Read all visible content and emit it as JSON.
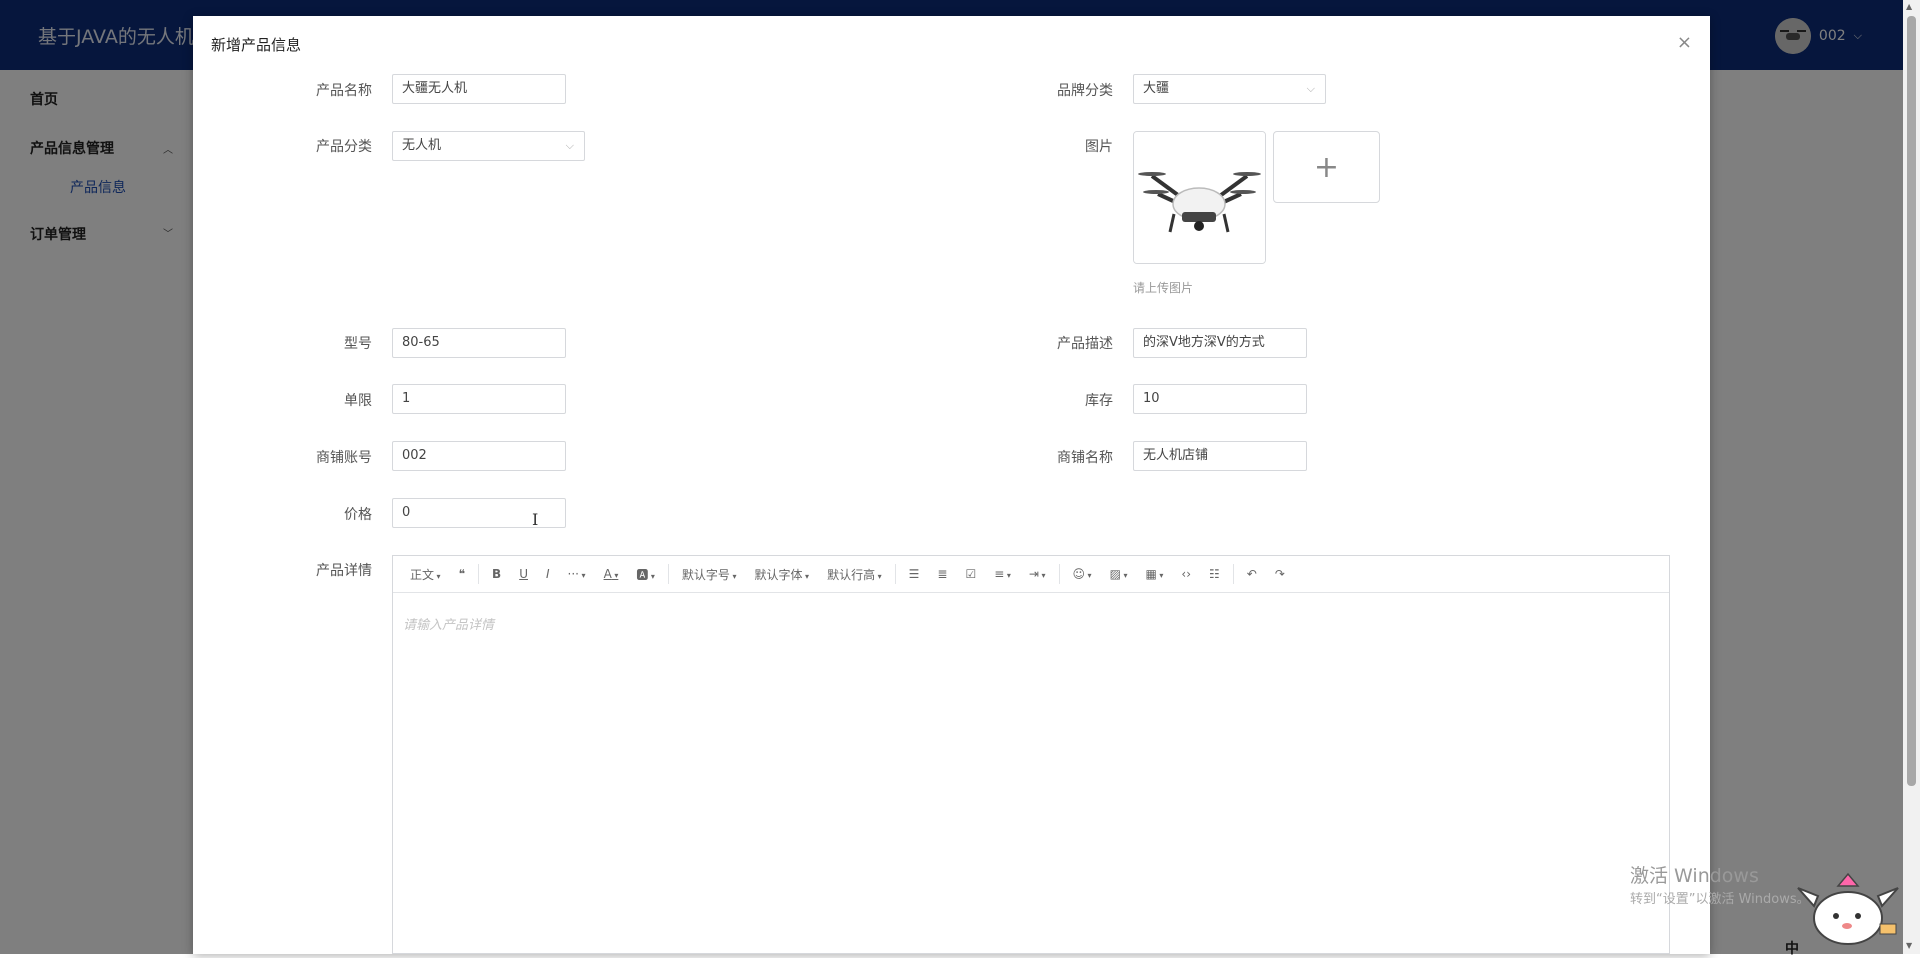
{
  "app": {
    "title": "基于JAVA的无人机",
    "user_name": "002"
  },
  "sidebar": {
    "items": [
      {
        "label": "首页"
      },
      {
        "label": "产品信息管理"
      },
      {
        "label": "订单管理"
      }
    ],
    "sub_items": [
      {
        "label": "产品信息"
      }
    ]
  },
  "dialog": {
    "title": "新增产品信息",
    "close_symbol": "×",
    "fields": {
      "product_name": {
        "label": "产品名称",
        "value": "大疆无人机"
      },
      "brand": {
        "label": "品牌分类",
        "value": "大疆"
      },
      "category": {
        "label": "产品分类",
        "value": "无人机"
      },
      "image": {
        "label": "图片",
        "hint": "请上传图片",
        "add_symbol": "+"
      },
      "model": {
        "label": "型号",
        "value": "80-65"
      },
      "description": {
        "label": "产品描述",
        "value": "的深V地方深V的方式"
      },
      "limit": {
        "label": "单限",
        "value": "1"
      },
      "stock": {
        "label": "库存",
        "value": "10"
      },
      "shop_account": {
        "label": "商铺账号",
        "value": "002"
      },
      "shop_name": {
        "label": "商铺名称",
        "value": "无人机店铺"
      },
      "price": {
        "label": "价格",
        "value": "0"
      },
      "details": {
        "label": "产品详情",
        "placeholder": "请输入产品详情"
      }
    },
    "toolbar": {
      "paragraph": "正文",
      "font_size": "默认字号",
      "font_family": "默认字体",
      "line_height": "默认行高"
    }
  },
  "watermark": {
    "line1": "激活 Windows",
    "line2": "转到“设置”以激活 Windows。"
  },
  "ime": {
    "label": "中"
  }
}
